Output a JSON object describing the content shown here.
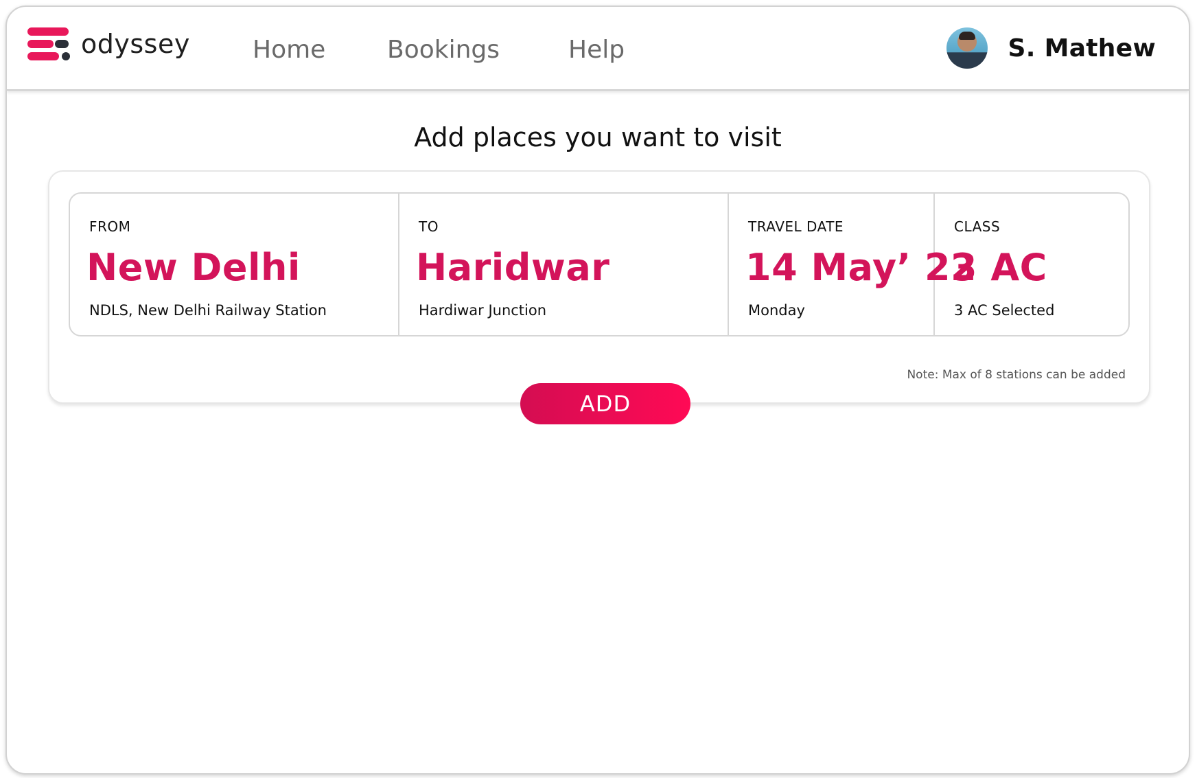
{
  "brand": {
    "name": "odyssey"
  },
  "nav": {
    "home": "Home",
    "bookings": "Bookings",
    "help": "Help"
  },
  "user": {
    "name": "S. Mathew"
  },
  "page": {
    "title": "Add places you want to visit"
  },
  "trip": {
    "from": {
      "label": "FROM",
      "value": "New Delhi",
      "sub": "NDLS, New Delhi Railway Station"
    },
    "to": {
      "label": "TO",
      "value": "Haridwar",
      "sub": "Hardiwar Junction"
    },
    "date": {
      "label": "TRAVEL DATE",
      "value": "14 May’ 22",
      "sub": "Monday"
    },
    "class": {
      "label": "CLASS",
      "value": "3 AC",
      "sub": "3 AC Selected"
    }
  },
  "note": "Note: Max of 8 stations can be added",
  "actions": {
    "add_label": "ADD"
  },
  "colors": {
    "accent": "#e8185a",
    "value_text": "#d3145a",
    "button_start": "#d40d52",
    "button_end": "#ff0a55"
  }
}
